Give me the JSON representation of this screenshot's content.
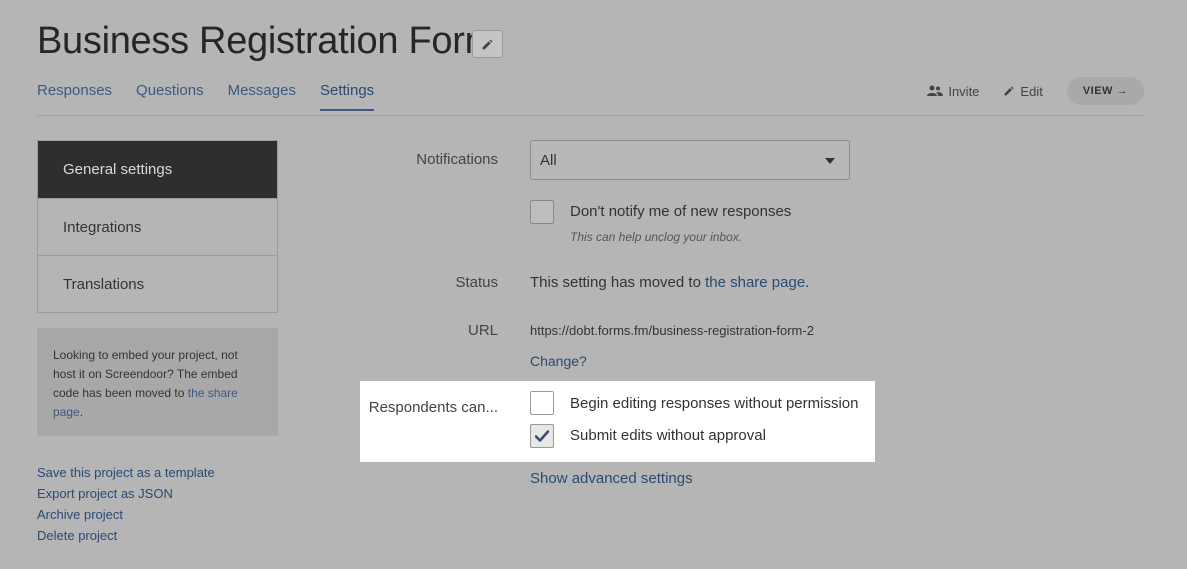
{
  "header": {
    "title": "Business Registration Form",
    "edit_icon": "pencil-icon",
    "tabs": [
      {
        "label": "Responses"
      },
      {
        "label": "Questions"
      },
      {
        "label": "Messages"
      },
      {
        "label": "Settings",
        "active": true
      }
    ],
    "actions": {
      "invite_label": "Invite",
      "edit_label": "Edit",
      "view_label": "VIEW →"
    }
  },
  "sidebar": {
    "items": [
      {
        "label": "General settings",
        "active": true
      },
      {
        "label": "Integrations"
      },
      {
        "label": "Translations"
      }
    ],
    "embed_note": {
      "text": "Looking to embed your project, not host it on Screendoor? The embed code has been moved to ",
      "link": "the share page",
      "end": "."
    },
    "links": [
      "Save this project as a template",
      "Export project as JSON",
      "Archive project",
      "Delete project"
    ]
  },
  "form": {
    "notifications": {
      "label": "Notifications",
      "selected": "All",
      "checkbox_label": "Don't notify me of new responses",
      "hint": "This can help unclog your inbox.",
      "checked": false
    },
    "status": {
      "label": "Status",
      "text": "This setting has moved to ",
      "link": "the share page",
      "end": "."
    },
    "url": {
      "label": "URL",
      "value": "https://dobt.forms.fm/business-registration-form-2",
      "change_link": "Change?"
    },
    "respondents": {
      "label": "Respondents can...",
      "options": [
        {
          "label": "Begin editing responses without permission",
          "checked": false
        },
        {
          "label": "Submit edits without approval",
          "checked": true
        }
      ]
    },
    "advanced_link": "Show advanced settings"
  },
  "colors": {
    "background": "#b5b5b5",
    "active_nav": "#2e2e2e",
    "link": "#2a4a72",
    "highlight": "#ffffff"
  }
}
